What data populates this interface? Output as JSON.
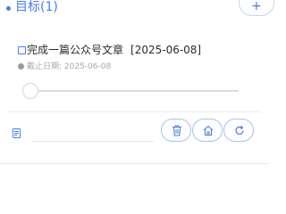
{
  "header": {
    "title": "目标(1)",
    "add_label": "+"
  },
  "goal": {
    "title": "完成一篇公众号文章",
    "date": "[2025-06-08]",
    "deadline_label": "截止日期:",
    "deadline_value": "2025-06-08",
    "progress": 0
  },
  "actions": {
    "note_placeholder": "",
    "icons": [
      "note-icon",
      "trash-icon",
      "home-icon",
      "refresh-icon"
    ]
  },
  "colors": {
    "accent": "#4a7ee8",
    "pill_border": "#a9c0ee",
    "muted": "#a8a8a8"
  }
}
